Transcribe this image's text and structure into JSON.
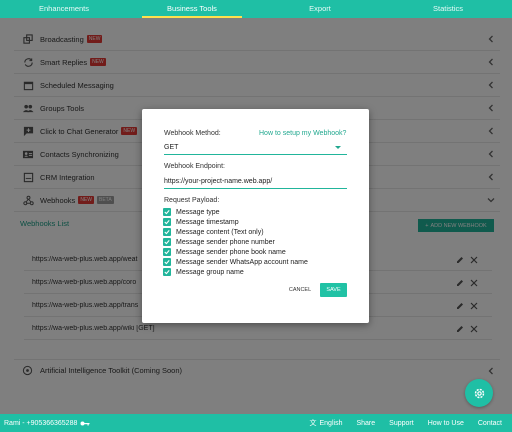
{
  "tabs": [
    {
      "label": "Enhancements"
    },
    {
      "label": "Business Tools"
    },
    {
      "label": "Export"
    },
    {
      "label": "Statistics"
    }
  ],
  "settings": [
    {
      "label": "Broadcasting",
      "badge": "NEW"
    },
    {
      "label": "Smart Replies",
      "badge": "NEW"
    },
    {
      "label": "Scheduled Messaging"
    },
    {
      "label": "Groups Tools"
    },
    {
      "label": "Click to Chat Generator",
      "badge": "NEW"
    },
    {
      "label": "Contacts Synchronizing"
    },
    {
      "label": "CRM Integration"
    },
    {
      "label": "Webhooks",
      "badge": "NEW",
      "badge2": "BETA"
    }
  ],
  "webhooks": {
    "title": "Webhooks List",
    "add_label": "ADD NEW WEBHOOK",
    "items": [
      {
        "url": "https://wa-web-plus.web.app/weat"
      },
      {
        "url": "https://wa-web-plus.web.app/coro"
      },
      {
        "url": "https://wa-web-plus.web.app/trans"
      },
      {
        "url": "https://wa-web-plus.web.app/wiki [GET]"
      }
    ]
  },
  "ai": {
    "label": "Artificial Intelligence Toolkit (Coming Soon)"
  },
  "footer": {
    "account": "Rami - +905366365288",
    "language": "English",
    "links": [
      "Share",
      "Support",
      "How to Use",
      "Contact"
    ]
  },
  "modal": {
    "method_label": "Webhook Method:",
    "help_link": "How to setup my Webhook?",
    "method_value": "GET",
    "endpoint_label": "Webhook Endpoint:",
    "endpoint_value": "https://your-project-name.web.app/",
    "payload_label": "Request Payload:",
    "payload": [
      "Message type",
      "Message timestamp",
      "Message content (Text only)",
      "Message sender phone number",
      "Message sender phone book name",
      "Message sender WhatsApp account name",
      "Message group name"
    ],
    "cancel_label": "CANCEL",
    "save_label": "SAVE"
  },
  "colors": {
    "accent": "#1fbfa5",
    "badge": "#e53935"
  }
}
